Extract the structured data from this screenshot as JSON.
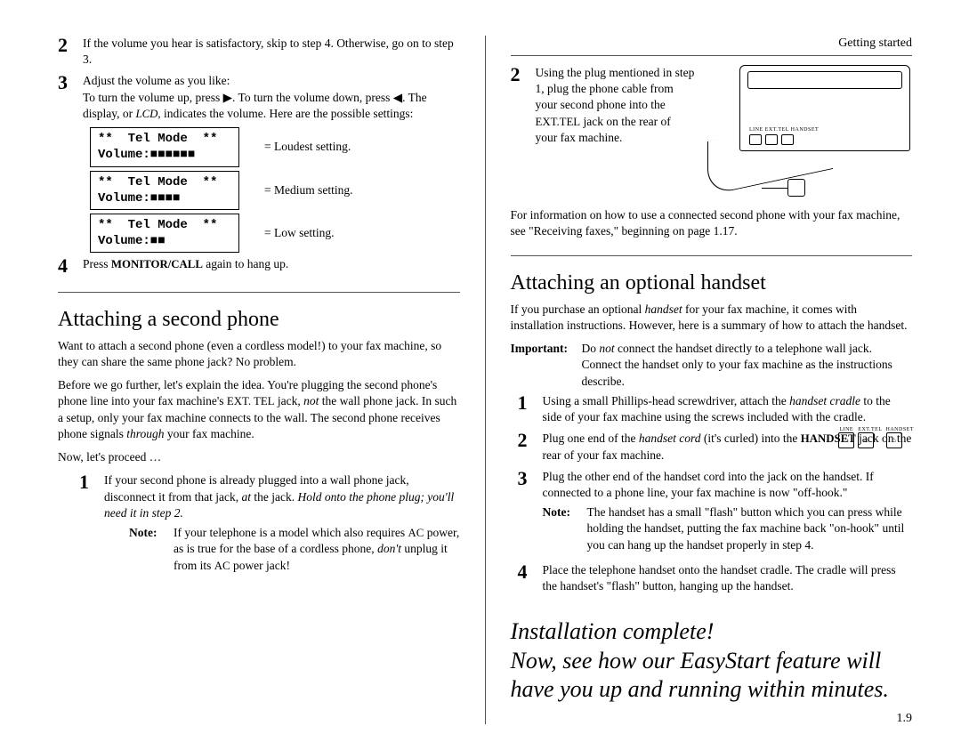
{
  "header": {
    "section": "Getting started"
  },
  "left": {
    "step2": "If the volume you hear is satisfactory, skip to step 4. Otherwise, go on to step 3.",
    "step3_a": "Adjust the volume as you like:",
    "step3_b_pre": "To turn the volume up, press ▶. To turn the volume down, press ◀. The display, or ",
    "step3_b_lcd": "LCD,",
    "step3_b_post": " indicates the volume. Here are the possible settings:",
    "lcd1_l1": "**  Tel Mode  **",
    "lcd1_l2": "Volume:■■■■■■",
    "lcd1_label": "= Loudest setting.",
    "lcd2_l1": "**  Tel Mode  **",
    "lcd2_l2": "Volume:■■■■",
    "lcd2_label": "= Medium setting.",
    "lcd3_l1": "**  Tel Mode  **",
    "lcd3_l2": "Volume:■■",
    "lcd3_label": "= Low setting.",
    "step4_pre": "Press ",
    "step4_key": "MONITOR/CALL",
    "step4_post": " again to hang up.",
    "h_second": "Attaching a second phone",
    "p1": "Want to attach a second phone (even a cordless model!) to your fax machine, so they can share the same phone jack? No problem.",
    "p2_a": "Before we go further, let's explain the idea. You're plugging the second phone's phone line into your fax machine's ",
    "p2_ext": "EXT. TEL",
    "p2_b": " jack, ",
    "p2_not": "not",
    "p2_c": " the wall phone jack. In such a setup, only your fax machine connects to the wall. The second phone receives phone signals ",
    "p2_thru": "through",
    "p2_d": " your fax machine.",
    "p3": "Now, let's proceed …",
    "s1_a": "If your second phone is already plugged into a wall phone jack, disconnect it from that jack, ",
    "s1_i1": "at",
    "s1_b": " the jack. ",
    "s1_i2": "Hold onto the phone plug; you'll need it in step 2.",
    "s1_note_a": "If your telephone is a model which also requires ",
    "s1_note_ac": "AC",
    "s1_note_b": " power, as is true for the base of a cordless phone, ",
    "s1_note_dont": "don't",
    "s1_note_c": " unplug it from its ",
    "s1_note_ac2": "AC",
    "s1_note_d": " power jack!"
  },
  "right": {
    "s2_a": "Using the plug mentioned in step 1, plug the phone cable from your second phone into the ",
    "s2_ext": "EXT.TEL",
    "s2_b": " jack on the rear of your fax machine.",
    "panel_caps": "LINE  EXT.TEL HANDSET",
    "caption": "For information on how to use a connected second phone with your fax machine, see \"Receiving faxes,\" beginning on page 1.17.",
    "h_handset": "Attaching an optional handset",
    "hp1_a": "If you purchase an optional ",
    "hp1_i": "handset",
    "hp1_b": " for your fax machine, it comes with installation instructions. However, here is a summary of how to attach the handset.",
    "imp_a": "Do ",
    "imp_not": "not",
    "imp_b": " connect the handset directly to a telephone wall jack. Connect the handset only to your fax machine as the instructions describe.",
    "hs1_a": "Using a small Phillips-head screwdriver, attach the ",
    "hs1_i": "handset cradle",
    "hs1_b": " to the side of your fax machine using the screws included with the cradle.",
    "hs2_a": "Plug one end of the ",
    "hs2_i": "handset cord",
    "hs2_b": " (it's curled) into the ",
    "hs2_sc": "HANDSET",
    "hs2_c": " jack on the rear of your fax machine.",
    "hs3": "Plug the other end of the handset cord into the jack on the handset. If connected to a phone line, your fax machine is now \"off-hook.\"",
    "hs3_note": "The handset has a small \"flash\" button which you can press while holding the handset, putting the fax machine back \"on-hook\" until you can hang up the handset properly in step 4.",
    "hs4": "Place the telephone handset onto the handset cradle. The cradle will press the handset's \"flash\" button, hanging up the handset.",
    "closing1": "Installation complete!",
    "closing2": "Now, see how our EasyStart feature will have you up and running within minutes."
  },
  "labels": {
    "note": "Note:",
    "important": "Important:",
    "line": "LINE",
    "exttel": "EXT.TEL",
    "handset": "HANDSET"
  },
  "pagenum": "1.9"
}
